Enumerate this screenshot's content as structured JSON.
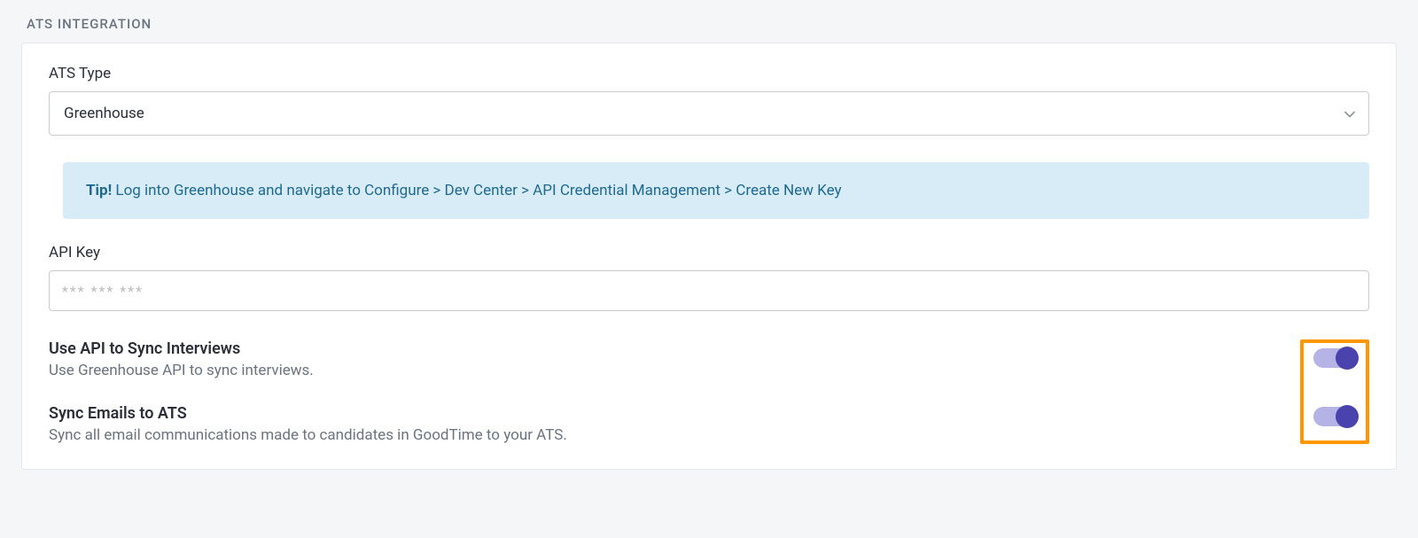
{
  "section": {
    "title": "ATS INTEGRATION"
  },
  "atsType": {
    "label": "ATS Type",
    "value": "Greenhouse"
  },
  "tip": {
    "label": "Tip!",
    "text": "Log into Greenhouse and navigate to Configure > Dev Center > API Credential Management > Create New Key"
  },
  "apiKey": {
    "label": "API Key",
    "placeholder": "*** *** ***",
    "value": ""
  },
  "toggles": {
    "syncInterviews": {
      "title": "Use API to Sync Interviews",
      "desc": "Use Greenhouse API to sync interviews.",
      "on": true
    },
    "syncEmails": {
      "title": "Sync Emails to ATS",
      "desc": "Sync all email communications made to candidates in GoodTime to your ATS.",
      "on": true
    }
  },
  "highlightColor": "#ff9800",
  "accentColor": "#4a42ad"
}
